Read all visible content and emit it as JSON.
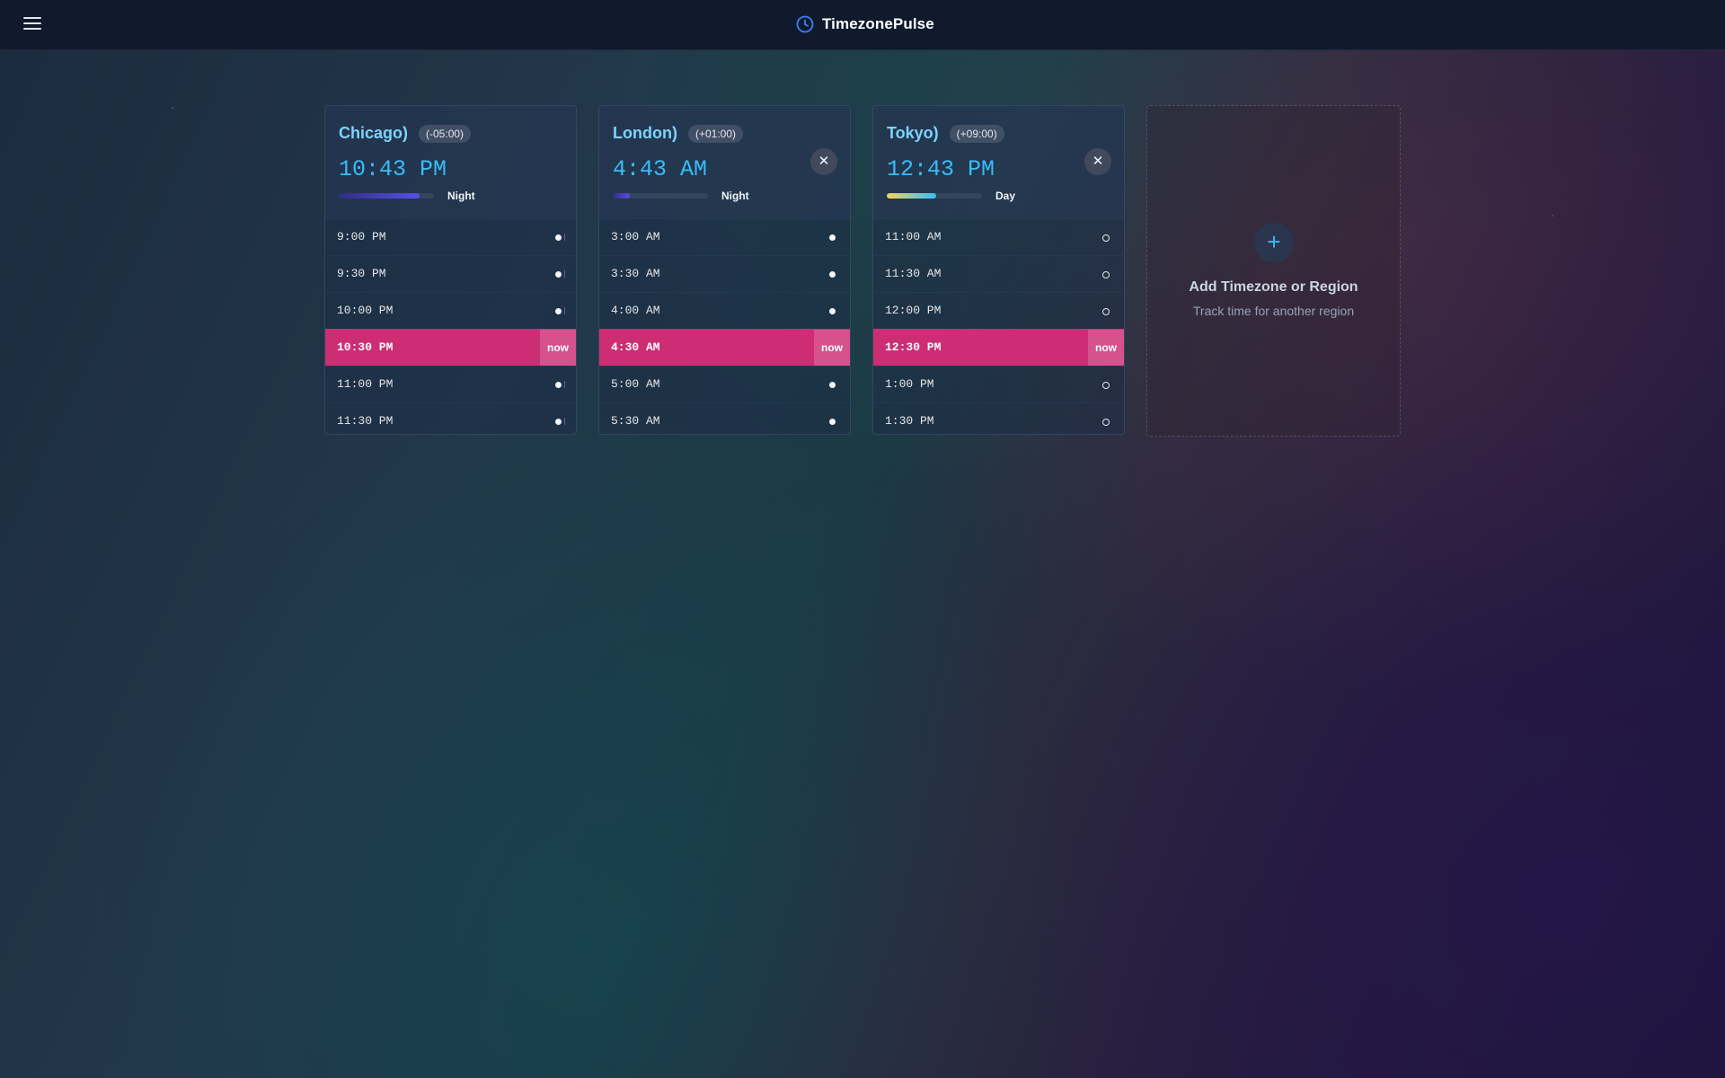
{
  "app": {
    "title": "TimezonePulse",
    "accent": "#38bdf8",
    "highlight": "#cc2d74"
  },
  "cards": [
    {
      "city": "Chicago)",
      "offset": "(-05:00)",
      "time": "10:43 PM",
      "period": "Night",
      "daylight_progress": 0.85,
      "closable": false,
      "slots": [
        {
          "time": "9:00 PM",
          "now": false
        },
        {
          "time": "9:30 PM",
          "now": false
        },
        {
          "time": "10:00 PM",
          "now": false
        },
        {
          "time": "10:30 PM",
          "now": true
        },
        {
          "time": "11:00 PM",
          "now": false
        },
        {
          "time": "11:30 PM",
          "now": false
        }
      ]
    },
    {
      "city": "London)",
      "offset": "(+01:00)",
      "time": "4:43 AM",
      "period": "Night",
      "daylight_progress": 0.18,
      "closable": true,
      "slots": [
        {
          "time": "3:00 AM",
          "now": false
        },
        {
          "time": "3:30 AM",
          "now": false
        },
        {
          "time": "4:00 AM",
          "now": false
        },
        {
          "time": "4:30 AM",
          "now": true
        },
        {
          "time": "5:00 AM",
          "now": false
        },
        {
          "time": "5:30 AM",
          "now": false
        }
      ]
    },
    {
      "city": "Tokyo)",
      "offset": "(+09:00)",
      "time": "12:43 PM",
      "period": "Day",
      "daylight_progress": 0.52,
      "closable": true,
      "slots": [
        {
          "time": "11:00 AM",
          "now": false
        },
        {
          "time": "11:30 AM",
          "now": false
        },
        {
          "time": "12:00 PM",
          "now": false
        },
        {
          "time": "12:30 PM",
          "now": true
        },
        {
          "time": "1:00 PM",
          "now": false
        },
        {
          "time": "1:30 PM",
          "now": false
        }
      ]
    }
  ],
  "now_label": "now",
  "close_symbol": "✕",
  "add_card": {
    "icon": "+",
    "title": "Add Timezone or Region",
    "subtitle": "Track time for another region"
  }
}
